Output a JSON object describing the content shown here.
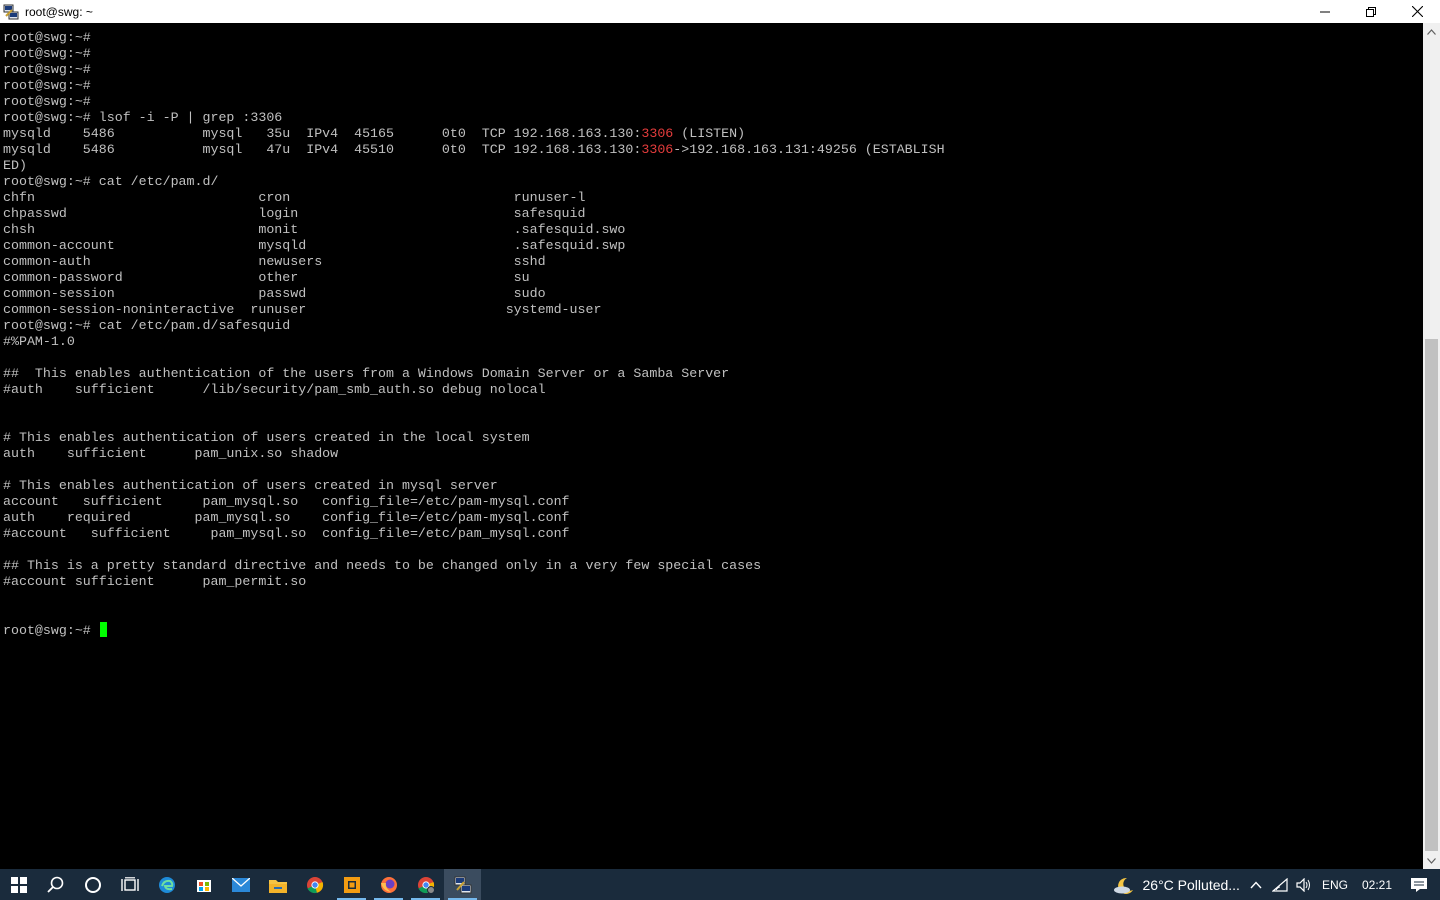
{
  "window": {
    "title": "root@swg: ~"
  },
  "terminal": {
    "lines": [
      [
        {
          "t": "root@swg:~#"
        }
      ],
      [
        {
          "t": "root@swg:~#"
        }
      ],
      [
        {
          "t": "root@swg:~#"
        }
      ],
      [
        {
          "t": "root@swg:~#"
        }
      ],
      [
        {
          "t": "root@swg:~#"
        }
      ],
      [
        {
          "t": "root@swg:~# lsof -i -P | grep :3306"
        }
      ],
      [
        {
          "t": "mysqld    5486           mysql   35u  IPv4  45165      0t0  TCP 192.168.163.130:"
        },
        {
          "t": "3306",
          "c": "red"
        },
        {
          "t": " (LISTEN)"
        }
      ],
      [
        {
          "t": "mysqld    5486           mysql   47u  IPv4  45510      0t0  TCP 192.168.163.130:"
        },
        {
          "t": "3306",
          "c": "red"
        },
        {
          "t": "->192.168.163.131:49256 (ESTABLISH"
        }
      ],
      [
        {
          "t": "ED)"
        }
      ],
      [
        {
          "t": "root@swg:~# cat /etc/pam.d/"
        }
      ],
      [
        {
          "t": "chfn                            cron                            runuser-l"
        }
      ],
      [
        {
          "t": "chpasswd                        login                           safesquid"
        }
      ],
      [
        {
          "t": "chsh                            monit                           .safesquid.swo"
        }
      ],
      [
        {
          "t": "common-account                  mysqld                          .safesquid.swp"
        }
      ],
      [
        {
          "t": "common-auth                     newusers                        sshd"
        }
      ],
      [
        {
          "t": "common-password                 other                           su"
        }
      ],
      [
        {
          "t": "common-session                  passwd                          sudo"
        }
      ],
      [
        {
          "t": "common-session-noninteractive  runuser                         systemd-user"
        }
      ],
      [
        {
          "t": "root@swg:~# cat /etc/pam.d/safesquid"
        }
      ],
      [
        {
          "t": "#%PAM-1.0"
        }
      ],
      [
        {
          "t": ""
        }
      ],
      [
        {
          "t": "##  This enables authentication of the users from a Windows Domain Server or a Samba Server"
        }
      ],
      [
        {
          "t": "#auth    sufficient      /lib/security/pam_smb_auth.so debug nolocal"
        }
      ],
      [
        {
          "t": ""
        }
      ],
      [
        {
          "t": ""
        }
      ],
      [
        {
          "t": "# This enables authentication of users created in the local system"
        }
      ],
      [
        {
          "t": "auth    sufficient      pam_unix.so shadow"
        }
      ],
      [
        {
          "t": ""
        }
      ],
      [
        {
          "t": "# This enables authentication of users created in mysql server"
        }
      ],
      [
        {
          "t": "account   sufficient     pam_mysql.so   config_file=/etc/pam-mysql.conf"
        }
      ],
      [
        {
          "t": "auth    required        pam_mysql.so    config_file=/etc/pam-mysql.conf"
        }
      ],
      [
        {
          "t": "#account   sufficient     pam_mysql.so  config_file=/etc/pam_mysql.conf"
        }
      ],
      [
        {
          "t": ""
        }
      ],
      [
        {
          "t": "## This is a pretty standard directive and needs to be changed only in a very few special cases"
        }
      ],
      [
        {
          "t": "#account sufficient      pam_permit.so"
        }
      ],
      [
        {
          "t": ""
        }
      ],
      [
        {
          "t": ""
        }
      ],
      [
        {
          "t": "root@swg:~# "
        }
      ]
    ]
  },
  "taskbar": {
    "weather": "26°C  Polluted...",
    "language": "ENG",
    "clock": "02:21",
    "apps": [
      "start-icon",
      "search-icon",
      "cortana-icon",
      "task-view-icon",
      "edge-icon",
      "store-icon",
      "mail-icon",
      "file-explorer-icon",
      "chrome-icon",
      "app-orange-icon",
      "firefox-icon",
      "chrome-alt-icon",
      "putty-icon"
    ]
  },
  "colors": {
    "terminal_bg": "#000000",
    "terminal_fg": "#c0c0c0",
    "port_highlight": "#e43c3c",
    "cursor": "#00ff00",
    "taskbar_bg": "#1a2b3c"
  }
}
